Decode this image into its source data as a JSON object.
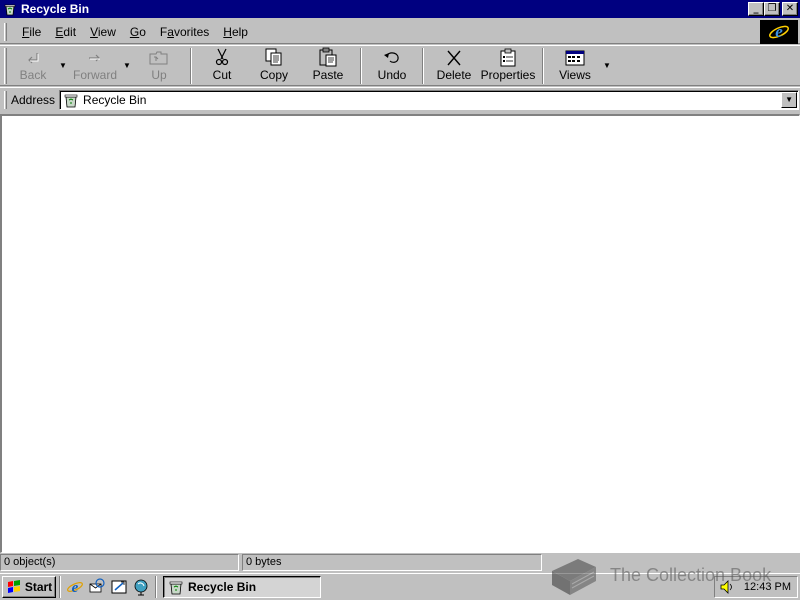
{
  "window": {
    "title": "Recycle Bin",
    "controls": {
      "minimize": "_",
      "restore": "❐",
      "close": "✕"
    }
  },
  "menu": {
    "items": [
      {
        "label": "File",
        "accel": "F"
      },
      {
        "label": "Edit",
        "accel": "E"
      },
      {
        "label": "View",
        "accel": "V"
      },
      {
        "label": "Go",
        "accel": "G"
      },
      {
        "label": "Favorites",
        "accel": "a"
      },
      {
        "label": "Help",
        "accel": "H"
      }
    ]
  },
  "toolbar": {
    "back": "Back",
    "forward": "Forward",
    "up": "Up",
    "cut": "Cut",
    "copy": "Copy",
    "paste": "Paste",
    "undo": "Undo",
    "delete": "Delete",
    "properties": "Properties",
    "views": "Views",
    "dropdown_glyph": "▼"
  },
  "address": {
    "label": "Address",
    "value": "Recycle Bin",
    "dropdown_glyph": "▼"
  },
  "status": {
    "objects": "0 object(s)",
    "size": "0 bytes"
  },
  "watermark": {
    "text": "The Collection Book"
  },
  "taskbar": {
    "start_label": "Start",
    "quick_launch": [
      "ie-icon",
      "outlook-express-icon",
      "show-desktop-icon",
      "channels-icon"
    ],
    "task_label": "Recycle Bin",
    "clock": "12:43 PM"
  },
  "colors": {
    "titlebar": "#000080",
    "face": "#c0c0c0",
    "shadow": "#808080",
    "highlight": "#ffffff"
  }
}
